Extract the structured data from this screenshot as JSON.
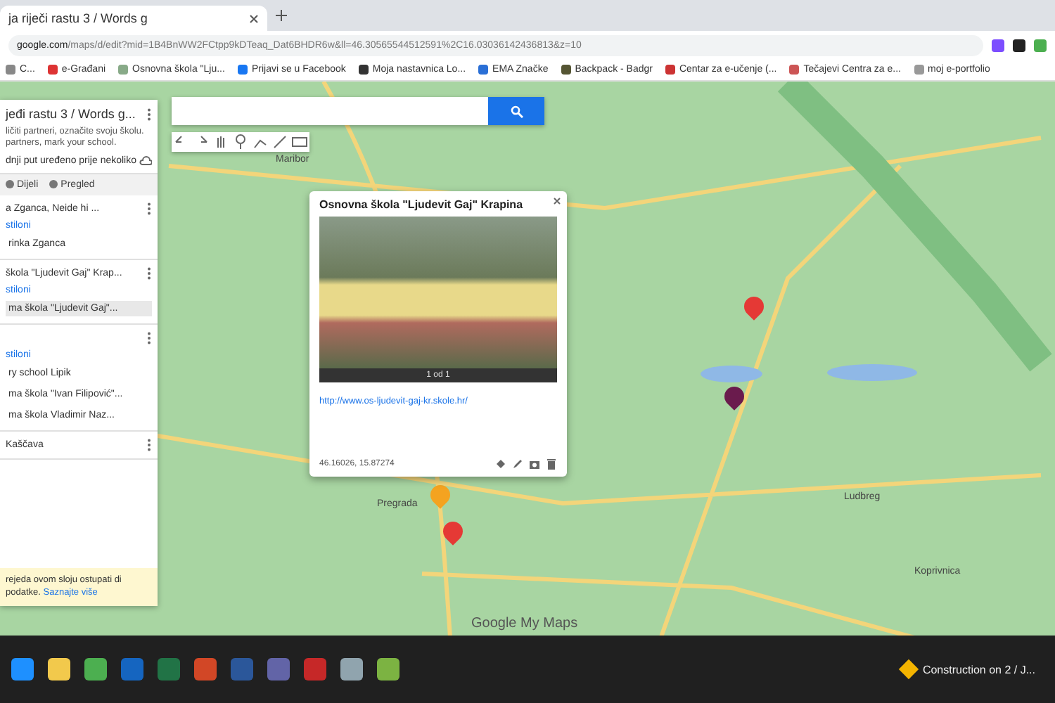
{
  "browser": {
    "tab_title": "ja riječi rastu 3 / Words g",
    "url_host": "google.com",
    "url_path": "/maps/d/edit?mid=1B4BnWW2FCtpp9kDTeaq_Dat6BHDR6w&ll=46.30565544512591%2C16.03036142436813&z=10",
    "bookmarks": [
      {
        "label": "C..."
      },
      {
        "label": "e-Građani"
      },
      {
        "label": "Osnovna škola \"Lju..."
      },
      {
        "label": "Prijavi se u Facebook"
      },
      {
        "label": "Moja nastavnica Lo..."
      },
      {
        "label": "EMA Značke"
      },
      {
        "label": "Backpack - Badgr"
      },
      {
        "label": "Centar za e-učenje (..."
      },
      {
        "label": "Tečajevi Centra za e..."
      },
      {
        "label": "moj e-portfolio"
      }
    ]
  },
  "sidebar": {
    "title": "jeđi rastu 3 / Words g...",
    "description": "ličiti partneri, označite svoju školu. partners, mark your school.",
    "last_edited": "dnji put uređeno prije nekoliko",
    "actions": [
      "Dijeli",
      "Pregled"
    ],
    "layers": [
      {
        "title": "a Zganca, Neide hi ... ",
        "link": "stiloni",
        "items": [
          {
            "label": "rinka Zganca",
            "selected": false
          }
        ]
      },
      {
        "title": "škola \"Ljudevit Gaj\" Krap...",
        "link": "stiloni",
        "items": [
          {
            "label": "ma škola \"Ljudevit Gaj\"...",
            "selected": true
          }
        ]
      },
      {
        "link": "stiloni",
        "items": [
          {
            "label": "ry school Lipik",
            "selected": false
          },
          {
            "label": "ma škola \"Ivan Filipović\"...",
            "selected": false
          },
          {
            "label": "ma škola Vladimir Naz...",
            "selected": false
          }
        ]
      },
      {
        "title": "Kaščava"
      }
    ],
    "notice": {
      "text": "rejeda ovom sloju ostupati di podatke.",
      "link": "Saznajte više"
    }
  },
  "popup": {
    "title": "Osnovna škola \"Ljudevit Gaj\" Krapina",
    "caption": "1 od 1",
    "link": "http://www.os-ljudevit-gaj-kr.skole.hr/",
    "coordinates": "46.16026, 15.87274"
  },
  "markers": [
    {
      "color": "#f4a320"
    },
    {
      "color": "#e53935"
    },
    {
      "color": "#e53935"
    },
    {
      "color": "#6a1b4d"
    }
  ],
  "map_labels": [
    {
      "text": "Maribor"
    },
    {
      "text": "Pregrada"
    },
    {
      "text": "Ludbreg"
    },
    {
      "text": "Koprivnica"
    }
  ],
  "attribution": "Google My Maps",
  "taskbar": {
    "notification": "Construction on 2 / J..."
  }
}
